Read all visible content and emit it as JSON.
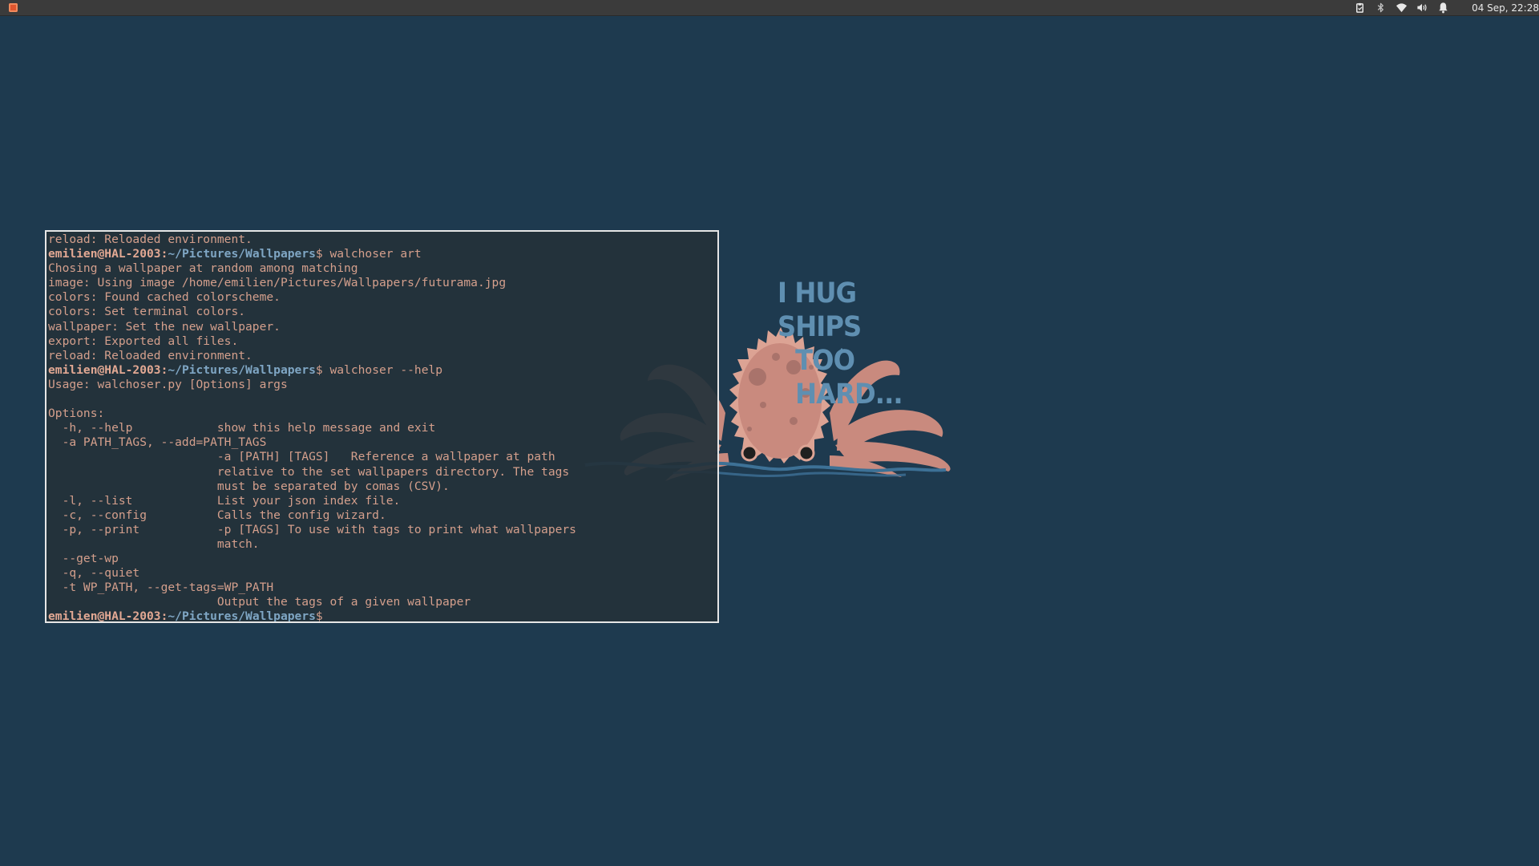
{
  "panel": {
    "clock": "04 Sep, 22:28",
    "menu_icon": "app-menu-icon",
    "tray_icons": [
      "clipboard-icon",
      "bluetooth-icon",
      "wifi-icon",
      "volume-icon",
      "notification-bell-icon"
    ]
  },
  "wallpaper": {
    "caption_line1": "I HUG SHIPS",
    "caption_line2": "TOO HARD...",
    "speech_mark": "/",
    "colors": {
      "background": "#1e3a4f",
      "octopus": "#c98a7e",
      "text": "#5f8fb1",
      "water": "#3d7196"
    }
  },
  "terminal": {
    "prompt": {
      "user_host": "emilien@HAL-2003",
      "separator": ":",
      "path": "~/Pictures/Wallpapers",
      "symbol": "$"
    },
    "lines": [
      {
        "type": "out",
        "text": "reload: Reloaded environment."
      },
      {
        "type": "prompt",
        "cmd": " walchoser art"
      },
      {
        "type": "out",
        "text": "Chosing a wallpaper at random among matching"
      },
      {
        "type": "out",
        "text": "image: Using image /home/emilien/Pictures/Wallpapers/futurama.jpg"
      },
      {
        "type": "out",
        "text": "colors: Found cached colorscheme."
      },
      {
        "type": "out",
        "text": "colors: Set terminal colors."
      },
      {
        "type": "out",
        "text": "wallpaper: Set the new wallpaper."
      },
      {
        "type": "out",
        "text": "export: Exported all files."
      },
      {
        "type": "out",
        "text": "reload: Reloaded environment."
      },
      {
        "type": "prompt",
        "cmd": " walchoser --help"
      },
      {
        "type": "out",
        "text": "Usage: walchoser.py [Options] args"
      },
      {
        "type": "out",
        "text": ""
      },
      {
        "type": "out",
        "text": "Options:"
      },
      {
        "type": "out",
        "text": "  -h, --help            show this help message and exit"
      },
      {
        "type": "out",
        "text": "  -a PATH_TAGS, --add=PATH_TAGS"
      },
      {
        "type": "out",
        "text": "                        -a [PATH] [TAGS]   Reference a wallpaper at path"
      },
      {
        "type": "out",
        "text": "                        relative to the set wallpapers directory. The tags"
      },
      {
        "type": "out",
        "text": "                        must be separated by comas (CSV)."
      },
      {
        "type": "out",
        "text": "  -l, --list            List your json index file."
      },
      {
        "type": "out",
        "text": "  -c, --config          Calls the config wizard."
      },
      {
        "type": "out",
        "text": "  -p, --print           -p [TAGS] To use with tags to print what wallpapers"
      },
      {
        "type": "out",
        "text": "                        match."
      },
      {
        "type": "out",
        "text": "  --get-wp"
      },
      {
        "type": "out",
        "text": "  -q, --quiet"
      },
      {
        "type": "out",
        "text": "  -t WP_PATH, --get-tags=WP_PATH"
      },
      {
        "type": "out",
        "text": "                        Output the tags of a given wallpaper"
      },
      {
        "type": "prompt",
        "cmd": " ",
        "cursor": "_"
      }
    ]
  }
}
